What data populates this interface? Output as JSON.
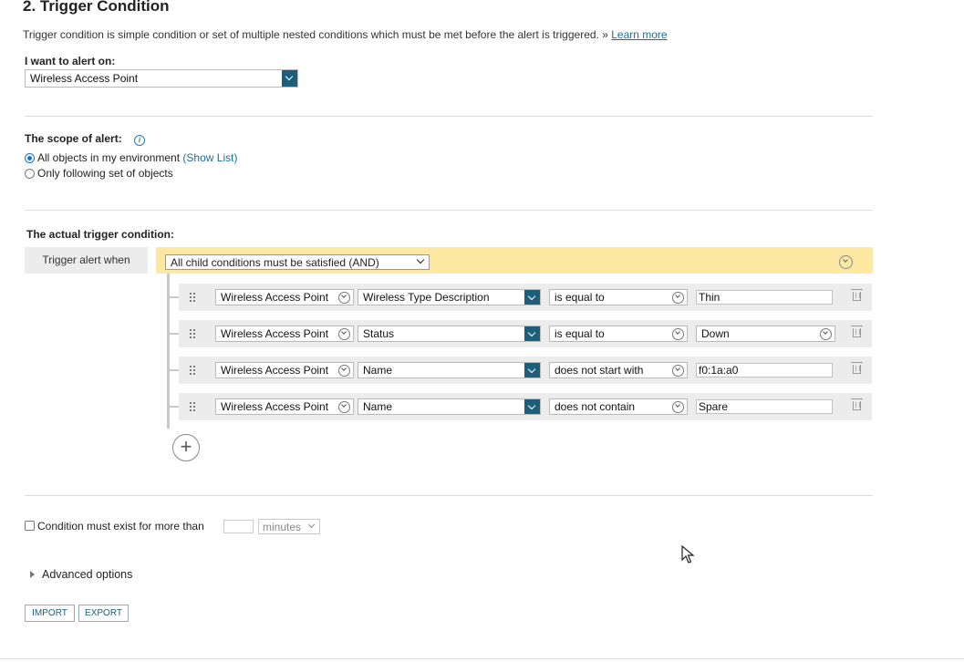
{
  "section": {
    "title": "2. Trigger Condition",
    "description": "Trigger condition is simple condition or set of multiple nested conditions which must be met before the alert is triggered. »",
    "learn_more": "Learn more"
  },
  "alert_on": {
    "label": "I want to alert on:",
    "value": "Wireless Access Point"
  },
  "scope": {
    "label": "The scope of alert:",
    "options": [
      {
        "label": "All objects in my environment",
        "selected": true,
        "link": "(Show List)"
      },
      {
        "label": "Only following set of objects",
        "selected": false
      }
    ]
  },
  "trigger": {
    "label": "The actual trigger condition:",
    "when_label": "Trigger alert when",
    "logic_value": "All child conditions must be satisfied (AND)",
    "conditions": [
      {
        "object": "Wireless Access Point",
        "field": "Wireless Type Description",
        "operator": "is equal to",
        "value": "Thin"
      },
      {
        "object": "Wireless Access Point",
        "field": "Status",
        "operator": "is equal to",
        "value": "Down"
      },
      {
        "object": "Wireless Access Point",
        "field": "Name",
        "operator": "does not start with",
        "value": "f0:1a:a0"
      },
      {
        "object": "Wireless Access Point",
        "field": "Name",
        "operator": "does not contain",
        "value": "Spare"
      }
    ],
    "add_icon": "plus-icon"
  },
  "duration": {
    "label": "Condition must exist for more than",
    "value": "",
    "unit": "minutes"
  },
  "advanced": {
    "label": "Advanced options"
  },
  "buttons": {
    "import": "IMPORT",
    "export": "EXPORT"
  },
  "colors": {
    "accent": "#1d5e7a",
    "and_bar": "#fce8a0",
    "row_bg": "#ececec",
    "link": "#1b6e97"
  }
}
